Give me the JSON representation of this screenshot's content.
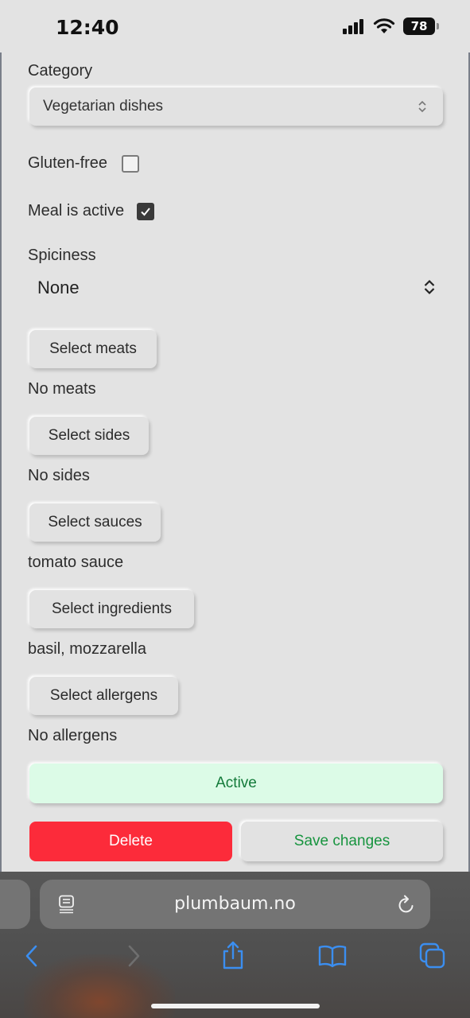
{
  "status_bar": {
    "time": "12:40",
    "battery": "78"
  },
  "form": {
    "category_label": "Category",
    "category_value": "Vegetarian dishes",
    "gluten_free_label": "Gluten-free",
    "gluten_free_checked": false,
    "meal_active_label": "Meal is active",
    "meal_active_checked": true,
    "spiciness_label": "Spiciness",
    "spiciness_value": "None",
    "meats_button": "Select meats",
    "meats_value": "No meats",
    "sides_button": "Select sides",
    "sides_value": "No sides",
    "sauces_button": "Select sauces",
    "sauces_value": "tomato sauce",
    "ingredients_button": "Select ingredients",
    "ingredients_value": "basil, mozzarella",
    "allergens_button": "Select allergens",
    "allergens_value": "No allergens",
    "status_button": "Active",
    "delete_button": "Delete",
    "save_button": "Save changes"
  },
  "browser": {
    "url": "plumbaum.no"
  },
  "colors": {
    "delete": "#fc2b3a",
    "save_text": "#17943f",
    "active_bg": "#dcfbe7",
    "active_text": "#137a3a"
  },
  "icons": [
    "signal-icon",
    "wifi-icon",
    "battery-icon",
    "updown-chevron-icon",
    "checkmark-icon",
    "reader-icon",
    "reload-icon",
    "back-icon",
    "forward-icon",
    "share-icon",
    "bookmarks-icon",
    "tabs-icon"
  ]
}
